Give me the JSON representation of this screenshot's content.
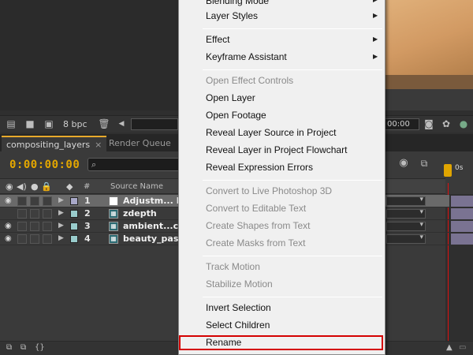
{
  "viewer_toolbar": {
    "bpc": "8 bpc",
    "timecode": "00:00"
  },
  "tabs": [
    {
      "label": "compositing_layers",
      "close": "×"
    },
    {
      "label": "Render Queue"
    }
  ],
  "comp": {
    "timecode": "0:00:00:00",
    "column_headers": {
      "number": "#",
      "source_name": "Source Name"
    },
    "ruler_label": "0s",
    "layers": [
      {
        "num": "1",
        "name": "Adjustm... La",
        "label_color": "#a8a8c8",
        "type": "white"
      },
      {
        "num": "2",
        "name": "zdepth",
        "label_color": "#9cc",
        "type": "footage"
      },
      {
        "num": "3",
        "name": "ambient...cc",
        "label_color": "#9cc",
        "type": "footage"
      },
      {
        "num": "4",
        "name": "beauty_pass",
        "label_color": "#9cc",
        "type": "footage"
      }
    ]
  },
  "menu": {
    "items": [
      {
        "label": "Blending Mode",
        "disabled": false,
        "submenu": true
      },
      {
        "label": "Layer Styles",
        "disabled": false,
        "submenu": true
      },
      {
        "label": "Effect",
        "disabled": false,
        "submenu": true
      },
      {
        "label": "Keyframe Assistant",
        "disabled": false,
        "submenu": true
      },
      {
        "label": "Open Effect Controls",
        "disabled": true
      },
      {
        "label": "Open Layer",
        "disabled": false
      },
      {
        "label": "Open Footage",
        "disabled": false
      },
      {
        "label": "Reveal Layer Source in Project",
        "disabled": false
      },
      {
        "label": "Reveal Layer in Project Flowchart",
        "disabled": false
      },
      {
        "label": "Reveal Expression Errors",
        "disabled": false
      },
      {
        "label": "Convert to Live Photoshop 3D",
        "disabled": true
      },
      {
        "label": "Convert to Editable Text",
        "disabled": true
      },
      {
        "label": "Create Shapes from Text",
        "disabled": true
      },
      {
        "label": "Create Masks from Text",
        "disabled": true
      },
      {
        "label": "Track Motion",
        "disabled": true
      },
      {
        "label": "Stabilize Motion",
        "disabled": true
      },
      {
        "label": "Invert Selection",
        "disabled": false
      },
      {
        "label": "Select Children",
        "disabled": false
      },
      {
        "label": "Rename",
        "disabled": false,
        "highlighted": true
      }
    ]
  },
  "colors": {
    "accent_timecode": "#e4a700",
    "highlight_box": "#d40000"
  }
}
